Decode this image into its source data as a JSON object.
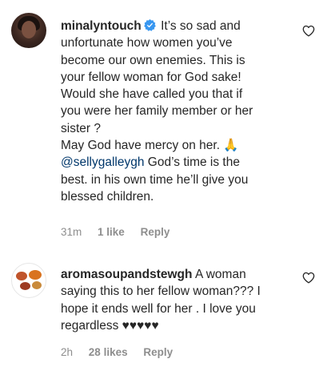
{
  "comments": [
    {
      "username": "minalyntouch",
      "verified": true,
      "text_lines": [
        "It’s so sad and",
        "unfortunate how women you’ve",
        "become our own enemies. This is",
        "your fellow woman for God sake!",
        "Would she have called you that if",
        "you were her family member or her",
        "sister ?",
        "May God have mercy on her. 🙏"
      ],
      "mention": "@sellygalleygh",
      "mention_after": "God’s time is the",
      "tail_lines": [
        "best. in his own time he’ll give you",
        "blessed children."
      ],
      "time": "31m",
      "likes": "1 like",
      "reply": "Reply",
      "avatar_icon": "profile-photo",
      "like_icon": "heart-outline-icon"
    },
    {
      "username": "aromasoupandstewgh",
      "verified": false,
      "text_first": "A woman",
      "text_lines": [
        "saying this to her fellow woman??? I",
        "hope it ends well for her . I love you",
        "regardless ♥♥♥♥♥"
      ],
      "time": "2h",
      "likes": "28 likes",
      "reply": "Reply",
      "avatar_icon": "soup-bowls-logo",
      "like_icon": "heart-outline-icon"
    }
  ],
  "colors": {
    "text": "#262626",
    "meta": "#8e8e8e",
    "mention": "#00376b",
    "verified": "#3897f0"
  }
}
